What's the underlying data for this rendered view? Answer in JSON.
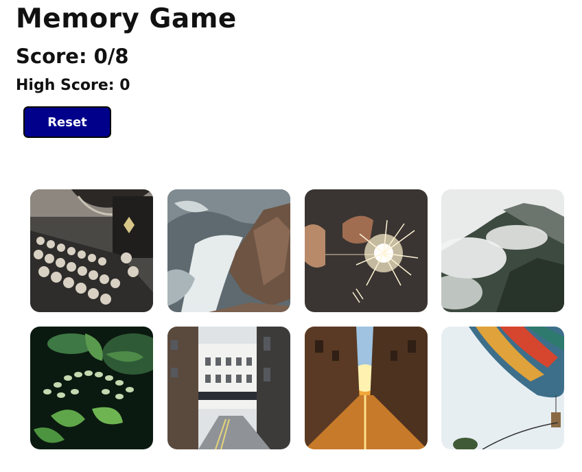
{
  "game": {
    "title": "Memory Game",
    "score_text": "Score: 0/8",
    "high_score_text": "High Score: 0",
    "reset_label": "Reset"
  },
  "colors": {
    "reset_button": "#00008b",
    "reset_text": "#ffffff",
    "background": "#ffffff"
  },
  "cards": [
    {
      "subject": "typewriter"
    },
    {
      "subject": "ocean-waves-rocks"
    },
    {
      "subject": "sparkler"
    },
    {
      "subject": "misty-mountain"
    },
    {
      "subject": "green-plant-buds"
    },
    {
      "subject": "city-street"
    },
    {
      "subject": "sunset-alley"
    },
    {
      "subject": "hot-air-balloon"
    }
  ]
}
